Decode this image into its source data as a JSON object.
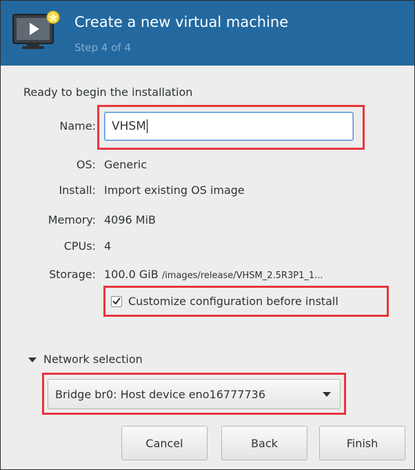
{
  "header": {
    "title": "Create a new virtual machine",
    "step": "Step 4 of 4"
  },
  "summary": {
    "ready_text": "Ready to begin the installation",
    "name_label": "Name:",
    "name_value": "VHSM",
    "os_label": "OS:",
    "os_value": "Generic",
    "install_label": "Install:",
    "install_value": "Import existing OS image",
    "memory_label": "Memory:",
    "memory_value": "4096 MiB",
    "cpus_label": "CPUs:",
    "cpus_value": "4",
    "storage_label": "Storage:",
    "storage_value": "100.0 GiB",
    "storage_path": "/images/release/VHSM_2.5R3P1_1..."
  },
  "customize": {
    "label": "Customize configuration before install",
    "checked": true
  },
  "network": {
    "section_label": "Network selection",
    "expanded": true,
    "selected": "Bridge br0: Host device eno16777736"
  },
  "buttons": {
    "cancel": "Cancel",
    "back": "Back",
    "finish": "Finish"
  },
  "colors": {
    "header_bg": "#2369a0",
    "highlight": "#e8353b",
    "focus_border": "#4a90d9"
  },
  "icons": {
    "header": "virtual-machine-new-icon",
    "checkbox": "checkmark-icon",
    "expander": "triangle-down-icon",
    "combo": "triangle-down-icon"
  }
}
